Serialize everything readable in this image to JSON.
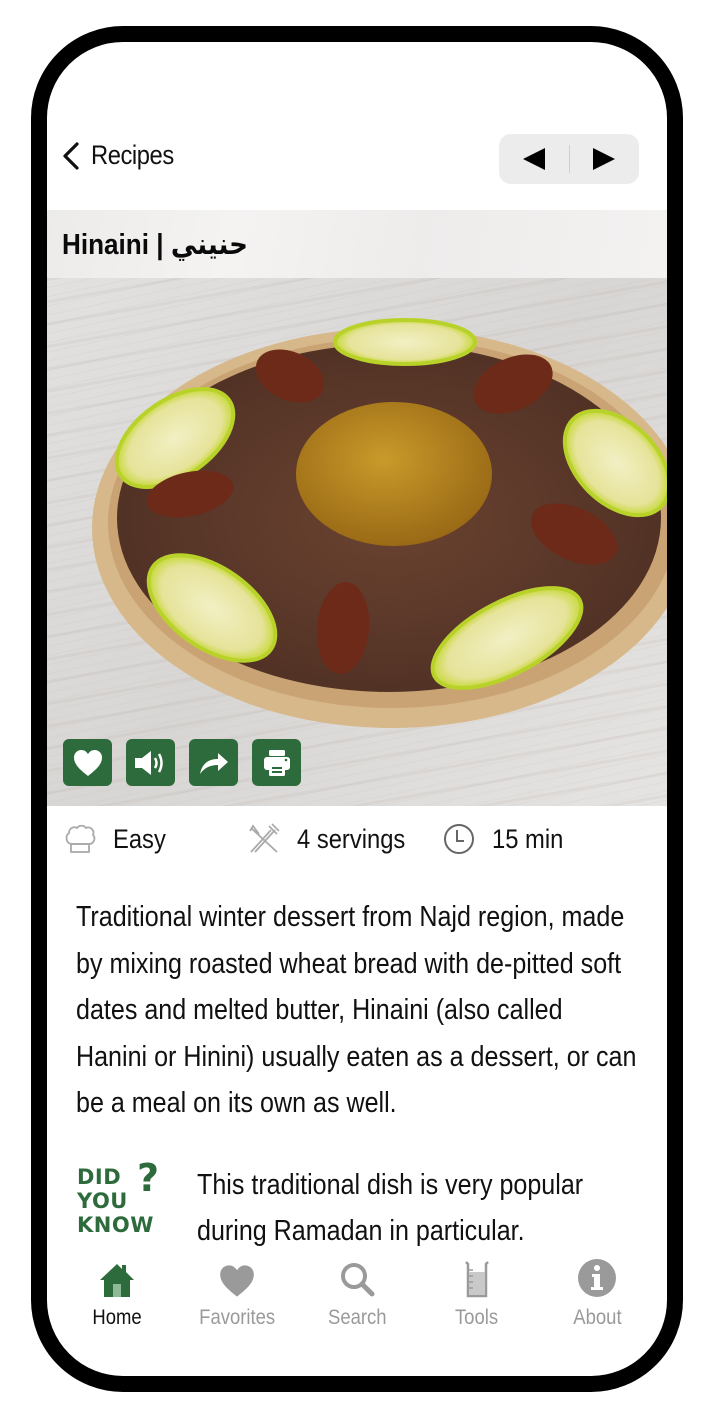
{
  "nav": {
    "back_label": "Recipes",
    "prev_label": "previous recipe",
    "next_label": "next recipe"
  },
  "recipe": {
    "title": "Hinaini | حنيني",
    "image_alt": "Hinaini dessert in a round dish topped with dates and lemon slices, melted butter in the center",
    "actions": [
      {
        "name": "favorite",
        "icon": "heart-icon"
      },
      {
        "name": "read-aloud",
        "icon": "speaker-icon"
      },
      {
        "name": "share",
        "icon": "share-icon"
      },
      {
        "name": "print",
        "icon": "printer-icon"
      }
    ],
    "meta": {
      "difficulty": "Easy",
      "servings": "4 servings",
      "time": "15 min"
    },
    "description": "Traditional winter dessert from Najd region, made by mixing roasted wheat bread with de-pitted soft dates and melted butter, Hinaini (also called Hanini or Hinini) usually eaten as a dessert, or can be a meal on its own as well.",
    "did_you_know": {
      "badge_lines": [
        "DID",
        "YOU",
        "KNOW"
      ],
      "badge_mark": "?",
      "text": "This traditional dish is very popular during Ramadan in particular."
    }
  },
  "tabbar": {
    "items": [
      {
        "label": "Home",
        "icon": "home-icon",
        "active": true
      },
      {
        "label": "Favorites",
        "icon": "heart-icon",
        "active": false
      },
      {
        "label": "Search",
        "icon": "search-icon",
        "active": false
      },
      {
        "label": "Tools",
        "icon": "measuring-cup-icon",
        "active": false
      },
      {
        "label": "About",
        "icon": "info-icon",
        "active": false
      }
    ]
  },
  "colors": {
    "accent_green": "#2e6b3c",
    "inactive_gray": "#9a9a9a",
    "frame": "#000000"
  }
}
